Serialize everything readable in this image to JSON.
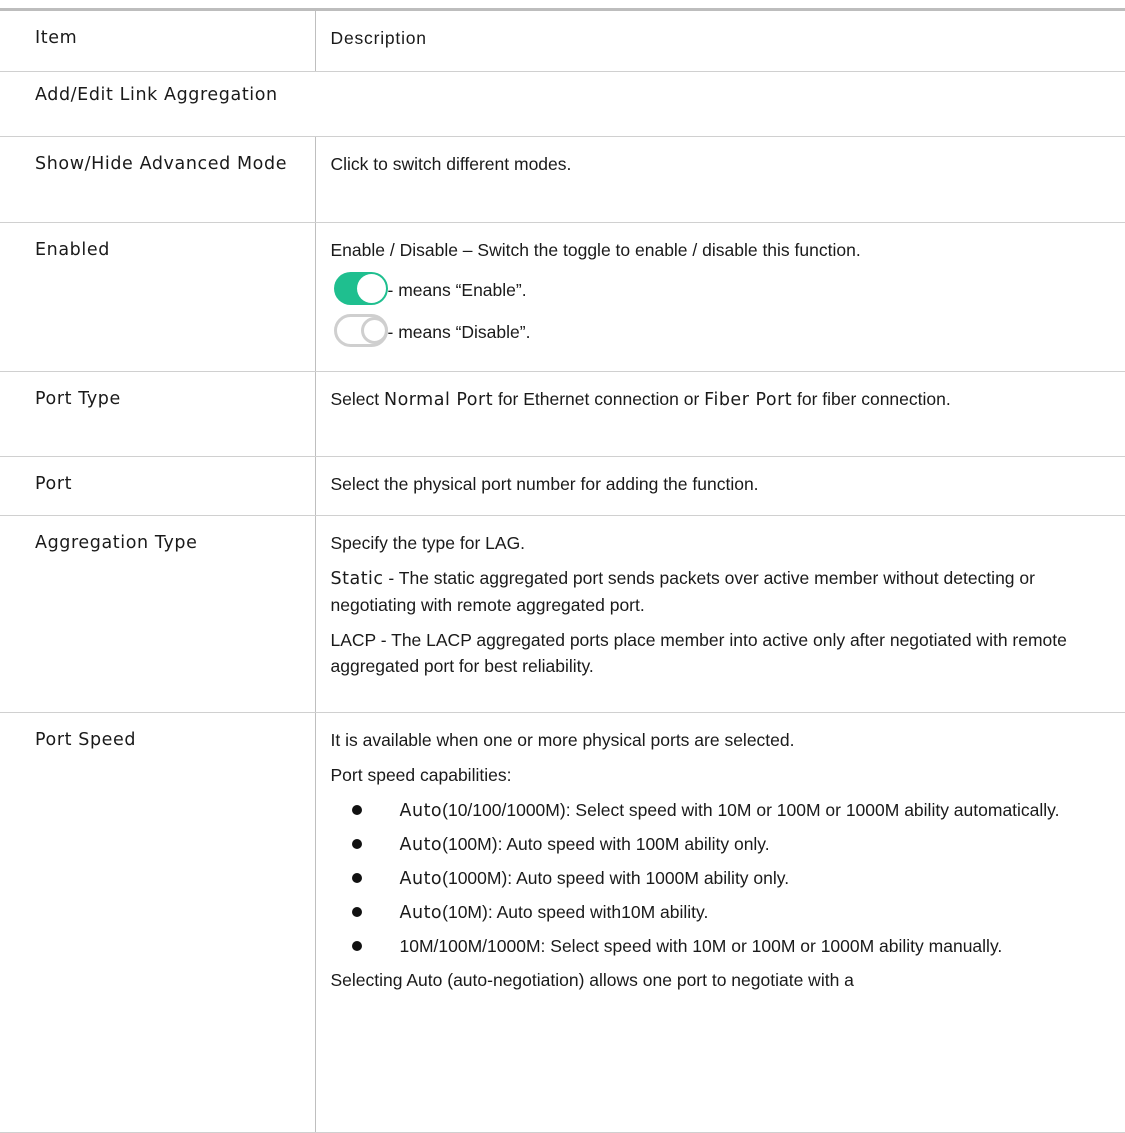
{
  "header": {
    "item": "Item",
    "description": "Description"
  },
  "section": "Add/Edit Link Aggregation",
  "rows": {
    "advanced": {
      "item": "Show/Hide Advanced Mode",
      "desc": "Click to switch different modes."
    },
    "enabled": {
      "item": "Enabled",
      "desc": "Enable / Disable – Switch the toggle to enable / disable this function.",
      "on_text": "- means “Enable”.",
      "off_text": "- means “Disable”."
    },
    "port_type": {
      "item": "Port Type",
      "pre": "Select ",
      "normal": "Normal Port",
      "mid": " for Ethernet connection or ",
      "fiber": "Fiber Port",
      "post": " for fiber connection."
    },
    "port": {
      "item": "Port",
      "desc": "Select the physical port number for adding the function."
    },
    "agg_type": {
      "item": "Aggregation Type",
      "p1": "Specify the type for LAG.",
      "static_kw": "Static",
      "static_desc": " - The static aggregated port sends packets over active member without detecting or negotiating with remote aggregated port.",
      "lacp_desc": "LACP - The LACP aggregated ports place member into active only after negotiated with remote aggregated port for best reliability."
    },
    "port_speed": {
      "item": "Port Speed",
      "p1": "It is available when one or more physical ports are selected.",
      "p2": "Port speed capabilities:",
      "bullets": [
        {
          "kw": "Auto",
          "rest": "(10/100/1000M): Select speed with 10M or 100M or 1000M ability automatically."
        },
        {
          "kw": "Auto",
          "rest": "(100M): Auto speed with 100M ability only."
        },
        {
          "kw": "Auto",
          "rest": "(1000M): Auto speed with 1000M ability only."
        },
        {
          "kw": "Auto",
          "rest": "(10M): Auto speed with10M ability."
        },
        {
          "kw": "",
          "rest": "10M/100M/1000M: Select speed with 10M or 100M or 1000M ability manually."
        }
      ],
      "p3": "Selecting Auto (auto-negotiation) allows one port to negotiate with a"
    }
  },
  "colors": {
    "toggle_on": "#1fbf8f",
    "toggle_off_border": "#cfcfcf"
  }
}
